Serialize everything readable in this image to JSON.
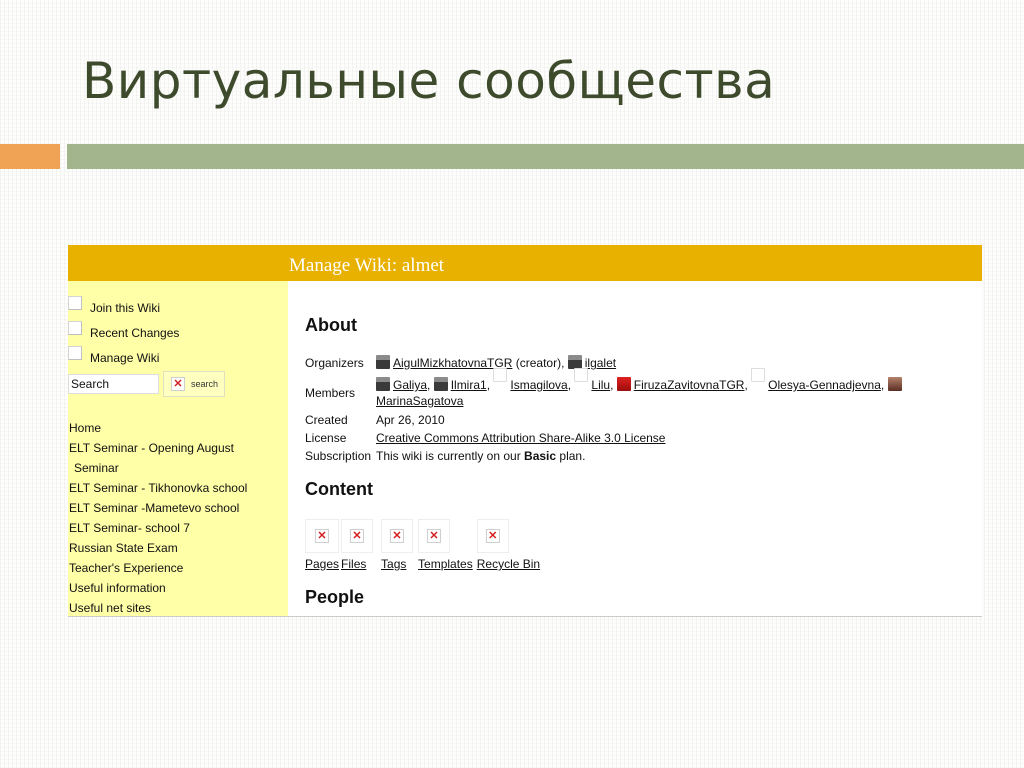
{
  "slide": {
    "title": "Виртуальные сообщества"
  },
  "colors": {
    "header_bg": "#e8b100",
    "sidebar_bg": "#ffffa8",
    "accent_orange": "#f0a354",
    "accent_green": "#a3b58d"
  },
  "wiki": {
    "header": "Manage Wiki: almet",
    "sidebar": {
      "links": [
        "Join this Wiki",
        "Recent Changes",
        "Manage Wiki"
      ],
      "search": {
        "value": "Search",
        "button": "search"
      },
      "nav": [
        "Home",
        "ELT Seminar - Opening August",
        "Seminar",
        "ELT Seminar - Tikhonovka school",
        "ELT Seminar -Mametevo school",
        "ELT Seminar- school 7",
        "Russian State Exam",
        "Teacher's Experience",
        "Useful information",
        "Useful net sites"
      ]
    },
    "about": {
      "heading": "About",
      "organizers_label": "Organizers",
      "organizers": {
        "creator": "AigulMizkhatovnaTGR",
        "creator_note": " (creator), ",
        "other": "ilgalet"
      },
      "members_label": "Members",
      "members": [
        "Galiya",
        "Ilmira1",
        "Ismagilova",
        "Lilu",
        "FiruzaZavitovnaTGR",
        "Olesya-Gennadjevna",
        "MarinaSagatova"
      ],
      "created_label": "Created",
      "created": "Apr 26, 2010",
      "license_label": "License",
      "license": "Creative Commons Attribution Share-Alike 3.0 License",
      "subscription_label": "Subscription",
      "subscription_pre": "This wiki is currently on our ",
      "subscription_plan": "Basic",
      "subscription_post": " plan."
    },
    "content": {
      "heading": "Content",
      "items": [
        "Pages",
        "Files",
        "Tags",
        "Templates",
        "Recycle Bin"
      ]
    },
    "people": {
      "heading": "People"
    }
  }
}
